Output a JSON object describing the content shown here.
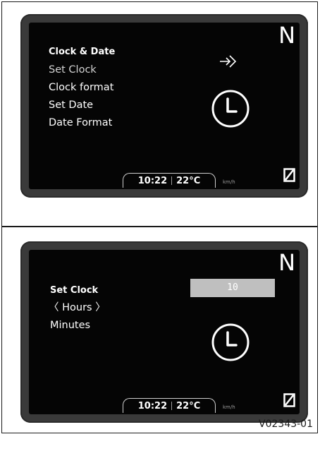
{
  "screen1": {
    "gear": "N",
    "menu_heading": "Clock & Date",
    "menu_items": [
      "Set Clock",
      "Clock format",
      "Set Date",
      "Date Format"
    ],
    "selected_index": 0,
    "time": "10:22",
    "temperature": "22°C",
    "speed_unit": "km/h"
  },
  "screen2": {
    "gear": "N",
    "menu_heading": "Set Clock",
    "menu_items": [
      "〈 Hours 〉",
      "Minutes"
    ],
    "value": "10",
    "time": "10:22",
    "temperature": "22°C",
    "speed_unit": "km/h"
  },
  "figure_code": "V02343-01"
}
